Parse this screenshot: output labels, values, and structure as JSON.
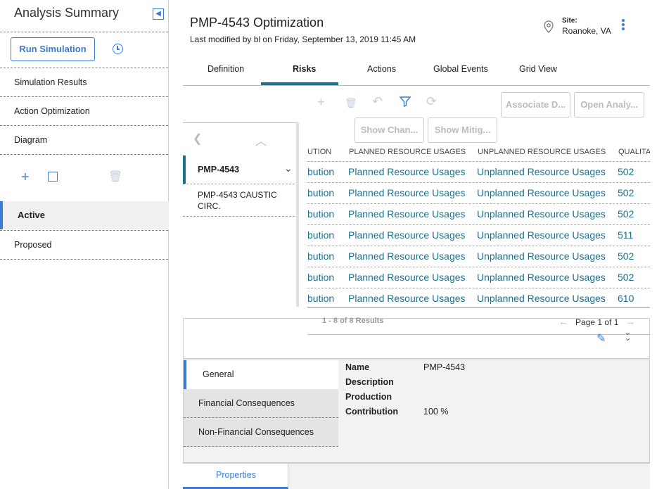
{
  "sidebar": {
    "title": "Analysis Summary",
    "run_button": "Run Simulation",
    "items": [
      "Simulation Results",
      "Action Optimization",
      "Diagram"
    ],
    "scenarios": [
      "Active",
      "Proposed"
    ]
  },
  "header": {
    "title": "PMP-4543 Optimization",
    "subtitle": "Last modified by bl on Friday, September 13, 2019 11:45 AM",
    "site_label": "Site:",
    "site_value": "Roanoke, VA"
  },
  "tabs": [
    "Definition",
    "Risks",
    "Actions",
    "Global Events",
    "Grid View"
  ],
  "toolbar": {
    "associate_button": "Associate D...",
    "open_analysis_button": "Open Analy...",
    "show_changes_button": "Show Chan...",
    "show_mitigation_button": "Show Mitig..."
  },
  "assets": {
    "selected": "PMP-4543",
    "items": [
      "PMP-4543 CAUSTIC CIRC."
    ]
  },
  "grid": {
    "columns": [
      "UTION",
      "PLANNED RESOURCE USAGES",
      "UNPLANNED RESOURCE USAGES",
      "QUALITA"
    ],
    "rows": [
      [
        "bution",
        "Planned Resource Usages",
        "Unplanned Resource Usages",
        "502"
      ],
      [
        "bution",
        "Planned Resource Usages",
        "Unplanned Resource Usages",
        "502"
      ],
      [
        "bution",
        "Planned Resource Usages",
        "Unplanned Resource Usages",
        "502"
      ],
      [
        "bution",
        "Planned Resource Usages",
        "Unplanned Resource Usages",
        "511"
      ],
      [
        "bution",
        "Planned Resource Usages",
        "Unplanned Resource Usages",
        "502"
      ],
      [
        "bution",
        "Planned Resource Usages",
        "Unplanned Resource Usages",
        "502"
      ],
      [
        "bution",
        "Planned Resource Usages",
        "Unplanned Resource Usages",
        "610"
      ]
    ],
    "results": "1 - 8 of 8 Results",
    "page_text": "Page 1 of 1"
  },
  "details": {
    "tabs": [
      "General",
      "Financial Consequences",
      "Non-Financial Consequences"
    ],
    "fields": [
      {
        "label": "Name",
        "value": "PMP-4543"
      },
      {
        "label": "Description",
        "value": ""
      },
      {
        "label": "Production",
        "value": ""
      },
      {
        "label": "Contribution",
        "value": "100 %"
      }
    ],
    "bottom_tab": "Properties"
  },
  "colors": {
    "accent": "#3a7bd5",
    "teal": "#1f6f8b"
  }
}
